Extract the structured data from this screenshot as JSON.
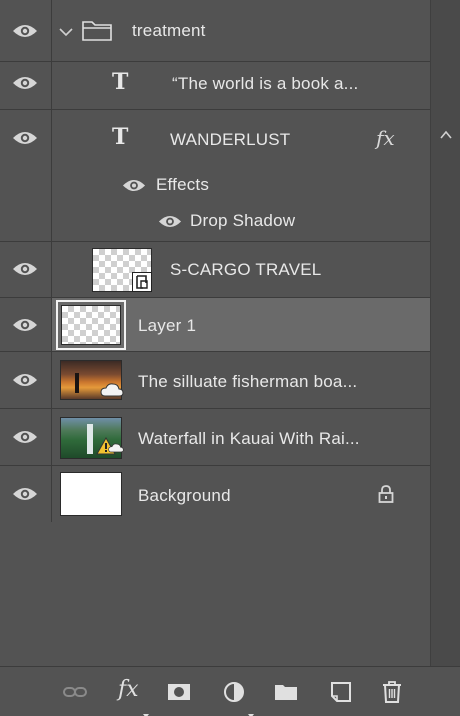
{
  "layers": {
    "group": {
      "name": "treatment"
    },
    "text1": {
      "name": "“The world is a book a..."
    },
    "text2": {
      "name": "WANDERLUST",
      "fx_label": "fx"
    },
    "effects": {
      "label": "Effects",
      "drop_shadow": "Drop Shadow"
    },
    "smart": {
      "name": "S-CARGO TRAVEL"
    },
    "layer1": {
      "name": "Layer 1"
    },
    "photo1": {
      "name": "The silluate fisherman boa..."
    },
    "photo2": {
      "name": "Waterfall in Kauai With Rai..."
    },
    "background": {
      "name": "Background"
    }
  },
  "toolbar": {
    "fx_label": "fx"
  },
  "icons": {
    "visibility": "eye-icon",
    "group": "folder-icon",
    "text_layer": "text-layer-icon",
    "lock": "lock-icon",
    "link": "link-icon",
    "mask": "mask-icon",
    "adjustment": "adjustment-icon",
    "new_group": "folder-icon",
    "new_layer": "new-layer-icon",
    "delete": "trash-icon"
  },
  "colors": {
    "panel_bg": "#535353",
    "selected_row": "#6a6a6a",
    "text": "#e8e8e8"
  }
}
